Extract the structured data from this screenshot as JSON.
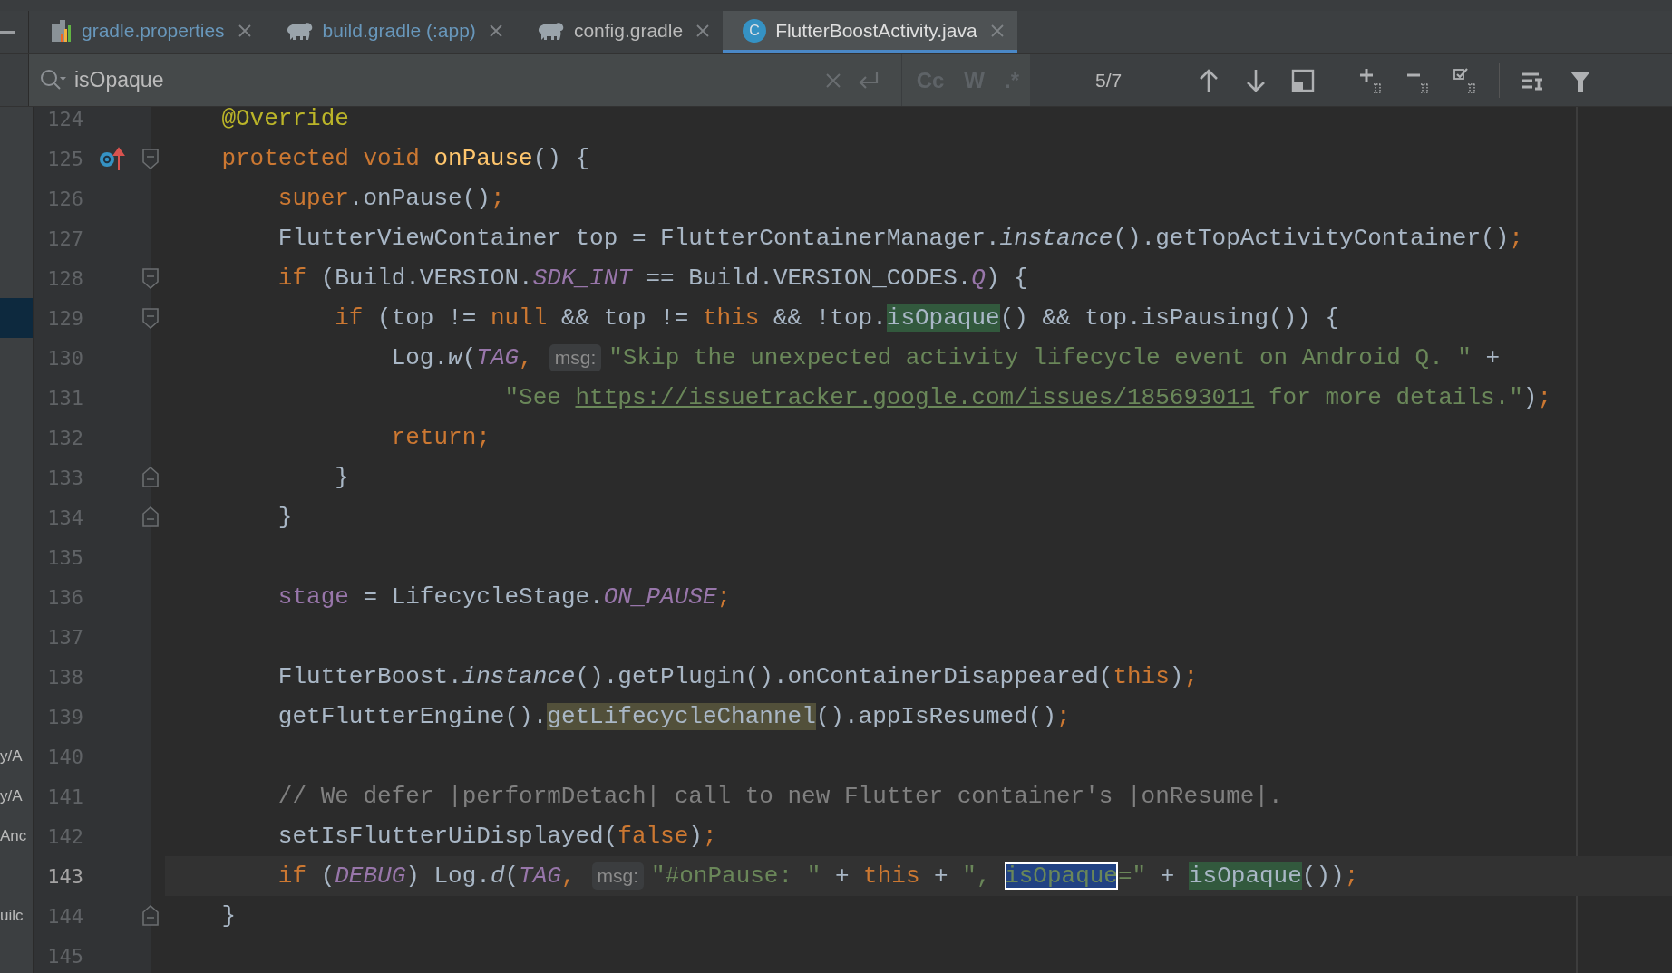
{
  "tabs": [
    {
      "label": "gradle.properties",
      "kind": "properties",
      "modified": true,
      "selected": false
    },
    {
      "label": "build.gradle (:app)",
      "kind": "gradle",
      "modified": true,
      "selected": false
    },
    {
      "label": "config.gradle",
      "kind": "gradle",
      "modified": false,
      "selected": false
    },
    {
      "label": "FlutterBoostActivity.java",
      "kind": "class",
      "icon_letter": "C",
      "modified": false,
      "selected": true
    }
  ],
  "search": {
    "value": "isOpaque",
    "options": [
      "Cc",
      "W",
      ".*"
    ],
    "match_count": "5/7"
  },
  "lines": [
    {
      "number": "124",
      "current": false,
      "tree_selected": false,
      "tokens": [
        {
          "text": "    @Override",
          "kind": "annotation"
        }
      ]
    },
    {
      "number": "125",
      "current": false,
      "tree_selected": false,
      "overrides": true,
      "fold_opens": true,
      "tokens": [
        {
          "text": "    protected",
          "kind": "keyword"
        },
        {
          "text": " void",
          "kind": "keyword"
        },
        {
          "text": " onPause",
          "kind": "declaration"
        },
        {
          "text": "() {",
          "kind": "plain"
        }
      ]
    },
    {
      "number": "126",
      "current": false,
      "tree_selected": false,
      "tokens": [
        {
          "text": "        super",
          "kind": "keyword"
        },
        {
          "text": ".onPause()",
          "kind": "plain"
        },
        {
          "text": ";",
          "kind": "keyword"
        }
      ]
    },
    {
      "number": "127",
      "current": false,
      "tree_selected": false,
      "tokens": [
        {
          "text": "        FlutterViewContainer top = FlutterContainerManager.",
          "kind": "plain"
        },
        {
          "text": "instance",
          "kind": "static-call"
        },
        {
          "text": "().getTopActivityContainer()",
          "kind": "plain"
        },
        {
          "text": ";",
          "kind": "keyword"
        }
      ]
    },
    {
      "number": "128",
      "current": false,
      "tree_selected": false,
      "fold_opens": true,
      "tokens": [
        {
          "text": "        if",
          "kind": "keyword"
        },
        {
          "text": " (Build.VERSION.",
          "kind": "plain"
        },
        {
          "text": "SDK_INT",
          "kind": "static-field"
        },
        {
          "text": " == Build.VERSION_CODES.",
          "kind": "plain"
        },
        {
          "text": "Q",
          "kind": "static-field"
        },
        {
          "text": ") {",
          "kind": "plain"
        }
      ]
    },
    {
      "number": "129",
      "current": false,
      "tree_selected": true,
      "fold_opens": true,
      "tokens": [
        {
          "text": "            if",
          "kind": "keyword"
        },
        {
          "text": " (top != ",
          "kind": "plain"
        },
        {
          "text": "null",
          "kind": "keyword"
        },
        {
          "text": " && top != ",
          "kind": "plain"
        },
        {
          "text": "this",
          "kind": "keyword"
        },
        {
          "text": " && !top.",
          "kind": "plain"
        },
        {
          "text": "isOpaque",
          "kind": "match"
        },
        {
          "text": "() && top.isPausing()) {",
          "kind": "plain"
        }
      ]
    },
    {
      "number": "130",
      "current": false,
      "tree_selected": false,
      "tokens": [
        {
          "text": "                Log.",
          "kind": "plain"
        },
        {
          "text": "w",
          "kind": "static-call"
        },
        {
          "text": "(",
          "kind": "plain"
        },
        {
          "text": "TAG",
          "kind": "static-field"
        },
        {
          "text": ",",
          "kind": "keyword"
        },
        {
          "text": "msg:",
          "kind": "hint"
        },
        {
          "text": "\"Skip the unexpected activity lifecycle event on Android Q. \"",
          "kind": "string"
        },
        {
          "text": " +",
          "kind": "plain"
        }
      ]
    },
    {
      "number": "131",
      "current": false,
      "tree_selected": false,
      "tokens": [
        {
          "text": "                        \"See ",
          "kind": "string"
        },
        {
          "text": "https://issuetracker.google.com/issues/185693011",
          "kind": "link"
        },
        {
          "text": " for more details.\"",
          "kind": "string"
        },
        {
          "text": ")",
          "kind": "plain"
        },
        {
          "text": ";",
          "kind": "keyword"
        }
      ]
    },
    {
      "number": "132",
      "current": false,
      "tree_selected": false,
      "tokens": [
        {
          "text": "                return",
          "kind": "keyword"
        },
        {
          "text": ";",
          "kind": "keyword"
        }
      ]
    },
    {
      "number": "133",
      "current": false,
      "tree_selected": false,
      "fold_closes": true,
      "tokens": [
        {
          "text": "            }",
          "kind": "plain"
        }
      ]
    },
    {
      "number": "134",
      "current": false,
      "tree_selected": false,
      "fold_closes": true,
      "tokens": [
        {
          "text": "        }",
          "kind": "plain"
        }
      ]
    },
    {
      "number": "135",
      "current": false,
      "tree_selected": false
    },
    {
      "number": "136",
      "current": false,
      "tree_selected": false,
      "tokens": [
        {
          "text": "        stage",
          "kind": "field"
        },
        {
          "text": " = LifecycleStage.",
          "kind": "plain"
        },
        {
          "text": "ON_PAUSE",
          "kind": "static-field"
        },
        {
          "text": ";",
          "kind": "keyword"
        }
      ]
    },
    {
      "number": "137",
      "current": false,
      "tree_selected": false
    },
    {
      "number": "138",
      "current": false,
      "tree_selected": false,
      "tokens": [
        {
          "text": "        FlutterBoost.",
          "kind": "plain"
        },
        {
          "text": "instance",
          "kind": "static-call"
        },
        {
          "text": "().getPlugin().onContainerDisappeared(",
          "kind": "plain"
        },
        {
          "text": "this",
          "kind": "keyword"
        },
        {
          "text": ")",
          "kind": "plain"
        },
        {
          "text": ";",
          "kind": "keyword"
        }
      ]
    },
    {
      "number": "139",
      "current": false,
      "tree_selected": false,
      "tokens": [
        {
          "text": "        getFlutterEngine().",
          "kind": "plain"
        },
        {
          "text": "getLifecycleChannel",
          "kind": "usage"
        },
        {
          "text": "().appIsResumed()",
          "kind": "plain"
        },
        {
          "text": ";",
          "kind": "keyword"
        }
      ]
    },
    {
      "number": "140",
      "current": false,
      "tree_selected": false,
      "tree_text": "y/A"
    },
    {
      "number": "141",
      "current": false,
      "tree_selected": false,
      "tree_text": "y/A",
      "tokens": [
        {
          "text": "        // We defer |performDetach| call to new Flutter container's |onResume|.",
          "kind": "comment"
        }
      ]
    },
    {
      "number": "142",
      "current": false,
      "tree_selected": false,
      "tree_text": "Anc",
      "tokens": [
        {
          "text": "        setIsFlutterUiDisplayed(",
          "kind": "plain"
        },
        {
          "text": "false",
          "kind": "keyword"
        },
        {
          "text": ")",
          "kind": "plain"
        },
        {
          "text": ";",
          "kind": "keyword"
        }
      ]
    },
    {
      "number": "143",
      "current": true,
      "tree_selected": false,
      "tokens": [
        {
          "text": "        if",
          "kind": "keyword"
        },
        {
          "text": " (",
          "kind": "plain"
        },
        {
          "text": "DEBUG",
          "kind": "static-field"
        },
        {
          "text": ") Log.",
          "kind": "plain"
        },
        {
          "text": "d",
          "kind": "static-call"
        },
        {
          "text": "(",
          "kind": "plain"
        },
        {
          "text": "TAG",
          "kind": "static-field"
        },
        {
          "text": ",",
          "kind": "keyword"
        },
        {
          "text": "msg:",
          "kind": "hint"
        },
        {
          "text": "\"#onPause: \"",
          "kind": "string"
        },
        {
          "text": " + ",
          "kind": "plain"
        },
        {
          "text": "this",
          "kind": "keyword"
        },
        {
          "text": " + ",
          "kind": "plain"
        },
        {
          "text": "\", ",
          "kind": "string"
        },
        {
          "text": "isOpaque",
          "kind": "current-match"
        },
        {
          "text": "=\"",
          "kind": "string"
        },
        {
          "text": " + ",
          "kind": "plain"
        },
        {
          "text": "isOpaque",
          "kind": "match"
        },
        {
          "text": "())",
          "kind": "plain"
        },
        {
          "text": ";",
          "kind": "keyword"
        }
      ]
    },
    {
      "number": "144",
      "current": false,
      "tree_selected": false,
      "tree_text": "uilc",
      "fold_closes": true,
      "tokens": [
        {
          "text": "    }",
          "kind": "plain"
        }
      ]
    },
    {
      "number": "145",
      "current": false,
      "tree_selected": false
    }
  ]
}
